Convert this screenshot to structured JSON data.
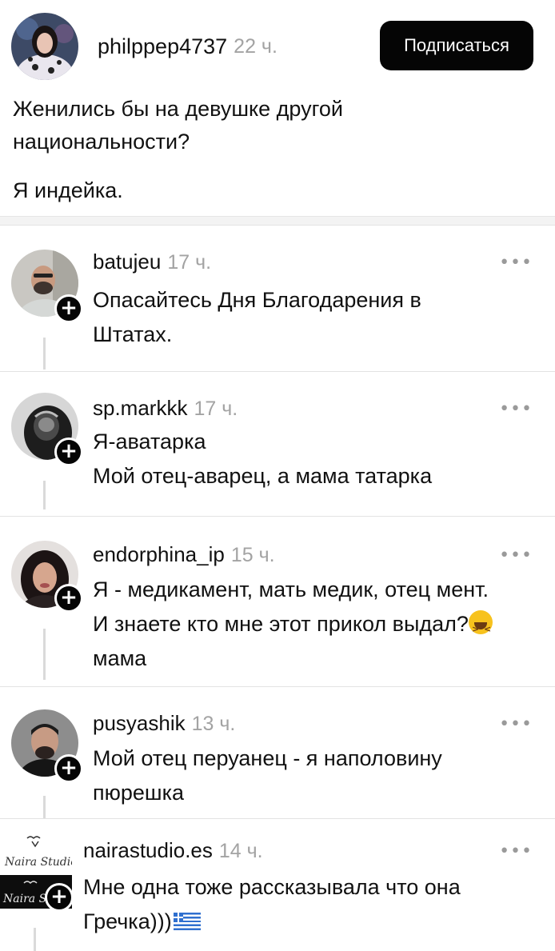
{
  "post": {
    "author": "philppep4737",
    "time": "22 ч.",
    "follow_label": "Подписаться",
    "question_line1": "Женились бы на девушке другой",
    "question_line2": "национальности?",
    "answer": "Я индейка."
  },
  "comments": [
    {
      "author": "batujeu",
      "time": "17 ч.",
      "lines": [
        "Опасайтесь Дня Благодарения в",
        "Штатах."
      ]
    },
    {
      "author": "sp.markkk",
      "time": "17 ч.",
      "lines": [
        "Я-аватарка",
        "Мой отец-аварец, а мама татарка"
      ]
    },
    {
      "author": "endorphina_ip",
      "time": "15 ч.",
      "lines": [
        "Я - медикамент, мать медик, отец мент.",
        "И знаете кто мне этот прикол выдал?",
        "мама"
      ]
    },
    {
      "author": "pusyashik",
      "time": "13 ч.",
      "lines": [
        "Мой отец перуанец - я наполовину",
        "пюрешка"
      ]
    },
    {
      "author": "nairastudio.es",
      "time": "14 ч.",
      "lines": [
        "Мне одна тоже рассказывала что она",
        "Гречка)))"
      ],
      "logo_text": "Naira Studio"
    }
  ],
  "ui": {
    "more_glyph": "•••",
    "plus_glyph": "+"
  },
  "icons": {
    "emoji": "laughing-face-emoji",
    "flag": "greece-flag-emoji"
  }
}
